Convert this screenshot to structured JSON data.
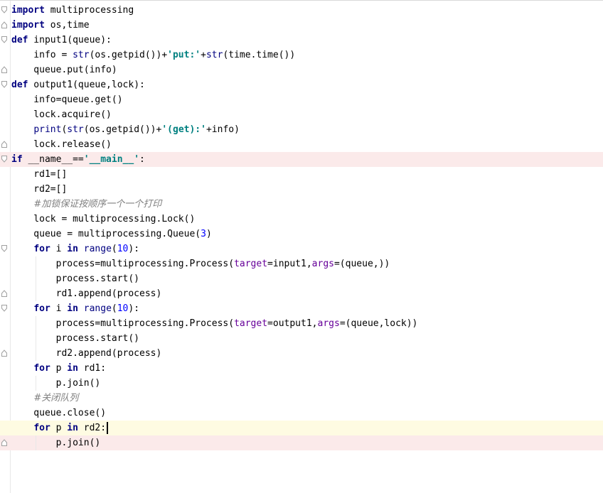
{
  "editor": {
    "language": "python",
    "highlight_pink": "#fbeaea",
    "highlight_yellow": "#fefbe2",
    "lines": [
      {
        "tokens": [
          [
            "kw",
            "import"
          ],
          [
            "p",
            " multiprocessing"
          ]
        ],
        "fold": "open",
        "hl": ""
      },
      {
        "tokens": [
          [
            "kw",
            "import"
          ],
          [
            "p",
            " os,time"
          ]
        ],
        "fold": "close",
        "hl": ""
      },
      {
        "tokens": [
          [
            "kw",
            "def"
          ],
          [
            "p",
            " input1(queue):"
          ]
        ],
        "fold": "open",
        "hl": ""
      },
      {
        "tokens": [
          [
            "p",
            "    info = "
          ],
          [
            "bi",
            "str"
          ],
          [
            "p",
            "(os.getpid())+"
          ],
          [
            "str",
            "'put:'"
          ],
          [
            "p",
            "+"
          ],
          [
            "bi",
            "str"
          ],
          [
            "p",
            "(time.time())"
          ]
        ],
        "fold": "",
        "hl": ""
      },
      {
        "tokens": [
          [
            "p",
            "    queue.put(info)"
          ]
        ],
        "fold": "close",
        "hl": ""
      },
      {
        "tokens": [
          [
            "kw",
            "def"
          ],
          [
            "p",
            " output1(queue,lock):"
          ]
        ],
        "fold": "open",
        "hl": ""
      },
      {
        "tokens": [
          [
            "p",
            "    info=queue.get()"
          ]
        ],
        "fold": "",
        "hl": ""
      },
      {
        "tokens": [
          [
            "p",
            "    lock.acquire()"
          ]
        ],
        "fold": "",
        "hl": ""
      },
      {
        "tokens": [
          [
            "p",
            "    "
          ],
          [
            "bi",
            "print"
          ],
          [
            "p",
            "("
          ],
          [
            "bi",
            "str"
          ],
          [
            "p",
            "(os.getpid())+"
          ],
          [
            "str",
            "'(get):'"
          ],
          [
            "p",
            "+info)"
          ]
        ],
        "fold": "",
        "hl": ""
      },
      {
        "tokens": [
          [
            "p",
            "    lock.release()"
          ]
        ],
        "fold": "close",
        "hl": ""
      },
      {
        "tokens": [
          [
            "kw",
            "if"
          ],
          [
            "p",
            " __name__=="
          ],
          [
            "str",
            "'__main__'"
          ],
          [
            "p",
            ":"
          ]
        ],
        "fold": "open",
        "hl": "pink"
      },
      {
        "tokens": [
          [
            "p",
            "    rd1=[]"
          ]
        ],
        "fold": "",
        "hl": ""
      },
      {
        "tokens": [
          [
            "p",
            "    rd2=[]"
          ]
        ],
        "fold": "",
        "hl": ""
      },
      {
        "tokens": [
          [
            "p",
            "    "
          ],
          [
            "cmt",
            "#加锁保证按顺序一个一个打印"
          ]
        ],
        "fold": "",
        "hl": ""
      },
      {
        "tokens": [
          [
            "p",
            "    lock = multiprocessing.Lock()"
          ]
        ],
        "fold": "",
        "hl": ""
      },
      {
        "tokens": [
          [
            "p",
            "    queue = multiprocessing.Queue("
          ],
          [
            "num",
            "3"
          ],
          [
            "p",
            ")"
          ]
        ],
        "fold": "",
        "hl": ""
      },
      {
        "tokens": [
          [
            "p",
            "    "
          ],
          [
            "kw",
            "for"
          ],
          [
            "p",
            " i "
          ],
          [
            "kw",
            "in"
          ],
          [
            "p",
            " "
          ],
          [
            "bi",
            "range"
          ],
          [
            "p",
            "("
          ],
          [
            "num",
            "10"
          ],
          [
            "p",
            "):"
          ]
        ],
        "fold": "open",
        "hl": ""
      },
      {
        "tokens": [
          [
            "p",
            "        process=multiprocessing.Process("
          ],
          [
            "kwarg",
            "target"
          ],
          [
            "p",
            "=input1,"
          ],
          [
            "kwarg",
            "args"
          ],
          [
            "p",
            "=(queue,))"
          ]
        ],
        "fold": "",
        "hl": ""
      },
      {
        "tokens": [
          [
            "p",
            "        process.start()"
          ]
        ],
        "fold": "",
        "hl": ""
      },
      {
        "tokens": [
          [
            "p",
            "        rd1.append(process)"
          ]
        ],
        "fold": "close",
        "hl": ""
      },
      {
        "tokens": [
          [
            "p",
            "    "
          ],
          [
            "kw",
            "for"
          ],
          [
            "p",
            " i "
          ],
          [
            "kw",
            "in"
          ],
          [
            "p",
            " "
          ],
          [
            "bi",
            "range"
          ],
          [
            "p",
            "("
          ],
          [
            "num",
            "10"
          ],
          [
            "p",
            "):"
          ]
        ],
        "fold": "open",
        "hl": ""
      },
      {
        "tokens": [
          [
            "p",
            "        process=multiprocessing.Process("
          ],
          [
            "kwarg",
            "target"
          ],
          [
            "p",
            "=output1,"
          ],
          [
            "kwarg",
            "args"
          ],
          [
            "p",
            "=(queue,lock))"
          ]
        ],
        "fold": "",
        "hl": ""
      },
      {
        "tokens": [
          [
            "p",
            "        process.start()"
          ]
        ],
        "fold": "",
        "hl": ""
      },
      {
        "tokens": [
          [
            "p",
            "        rd2.append(process)"
          ]
        ],
        "fold": "close",
        "hl": ""
      },
      {
        "tokens": [
          [
            "p",
            "    "
          ],
          [
            "kw",
            "for"
          ],
          [
            "p",
            " p "
          ],
          [
            "kw",
            "in"
          ],
          [
            "p",
            " rd1:"
          ]
        ],
        "fold": "",
        "hl": ""
      },
      {
        "tokens": [
          [
            "p",
            "        p.join()"
          ]
        ],
        "fold": "",
        "hl": ""
      },
      {
        "tokens": [
          [
            "p",
            "    "
          ],
          [
            "cmt",
            "#关闭队列"
          ]
        ],
        "fold": "",
        "hl": ""
      },
      {
        "tokens": [
          [
            "p",
            "    queue.close()"
          ]
        ],
        "fold": "",
        "hl": ""
      },
      {
        "tokens": [
          [
            "p",
            "    "
          ],
          [
            "kw",
            "for"
          ],
          [
            "p",
            " p "
          ],
          [
            "kw",
            "in"
          ],
          [
            "p",
            " rd2:"
          ],
          [
            "caret",
            ""
          ]
        ],
        "fold": "",
        "hl": "yellow"
      },
      {
        "tokens": [
          [
            "p",
            "        p.join()"
          ]
        ],
        "fold": "close",
        "hl": "pink"
      }
    ]
  }
}
